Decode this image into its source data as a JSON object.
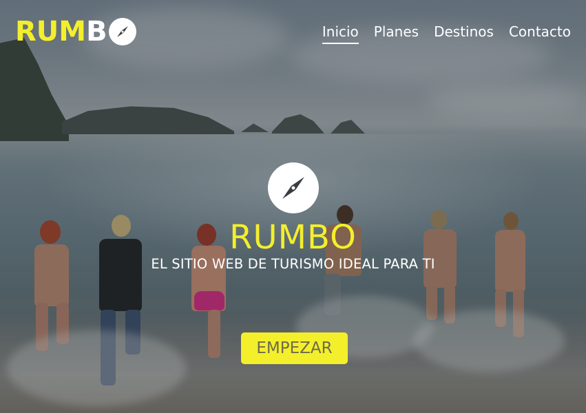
{
  "brand": {
    "logo_part_a": "RUM",
    "logo_part_b": "B",
    "logo_icon": "compass-icon",
    "accent_color": "#f4ef2b"
  },
  "nav": {
    "items": [
      {
        "label": "Inicio",
        "active": true
      },
      {
        "label": "Planes",
        "active": false
      },
      {
        "label": "Destinos",
        "active": false
      },
      {
        "label": "Contacto",
        "active": false
      }
    ]
  },
  "hero": {
    "icon": "compass-icon",
    "title": "RUMBO",
    "subtitle": "EL SITIO WEB DE TURISMO IDEAL PARA TI",
    "cta_label": "EMPEZAR",
    "background": "beach-people-running-into-sea-photo"
  }
}
